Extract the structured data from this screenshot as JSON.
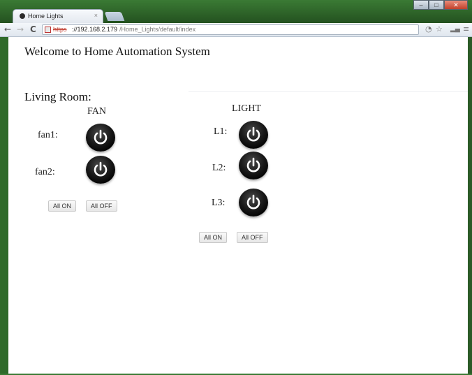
{
  "browser": {
    "tab_title": "Home Lights",
    "tab_close": "×",
    "url_scheme": "https",
    "url_host": "://192.168.2.179",
    "url_path": "/Home_Lights/default/index"
  },
  "page": {
    "welcome": "Welcome to Home Automation System",
    "section_title": "Living Room:"
  },
  "fan": {
    "heading": "FAN",
    "devices": [
      {
        "label": "fan1:"
      },
      {
        "label": "fan2:"
      }
    ],
    "all_on": "All ON",
    "all_off": "All OFF"
  },
  "light": {
    "heading": "LIGHT",
    "devices": [
      {
        "label": "L1:"
      },
      {
        "label": "L2:"
      },
      {
        "label": "L3:"
      }
    ],
    "all_on": "All ON",
    "all_off": "All OFF"
  },
  "icons": {
    "power": "power-icon",
    "favicon": "favicon-icon",
    "lock": "broken-lock-icon",
    "star": "star-icon",
    "menu": "menu-icon"
  },
  "colors": {
    "power_button": "#000000",
    "power_glyph": "#ffffff",
    "url_scheme": "#c0392b"
  }
}
